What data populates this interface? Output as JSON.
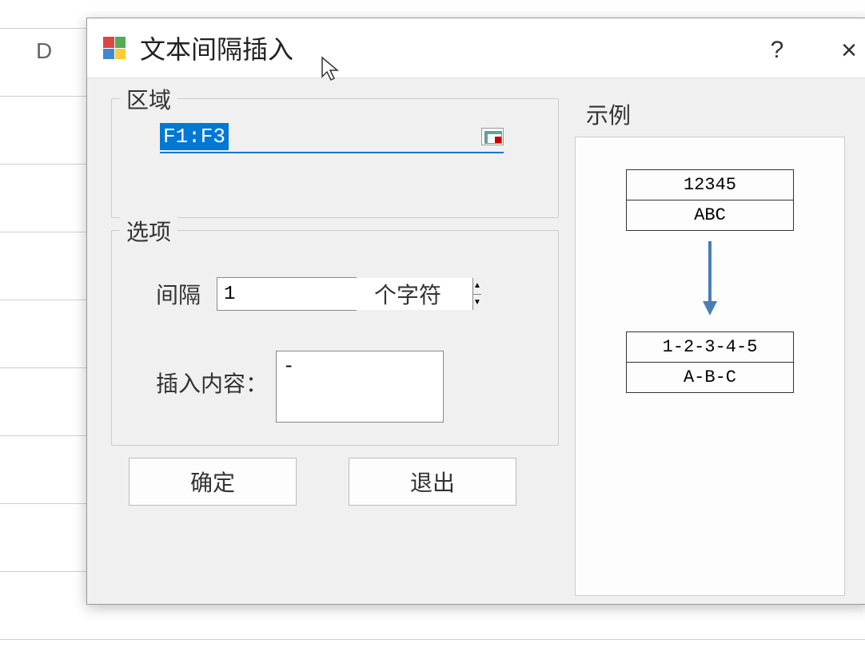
{
  "background": {
    "column_d_label": "D"
  },
  "dialog": {
    "title": "文本间隔插入",
    "help_label": "?",
    "close_label": "×",
    "region": {
      "legend": "区域",
      "range_value": "F1:F3"
    },
    "options": {
      "legend": "选项",
      "interval_label": "间隔",
      "interval_value": "1",
      "interval_suffix": "个字符",
      "insert_label": "插入内容：",
      "insert_value": "-"
    },
    "buttons": {
      "ok": "确定",
      "exit": "退出"
    },
    "example": {
      "legend": "示例",
      "before": [
        "12345",
        "ABC"
      ],
      "after": [
        "1-2-3-4-5",
        "A-B-C"
      ]
    }
  }
}
